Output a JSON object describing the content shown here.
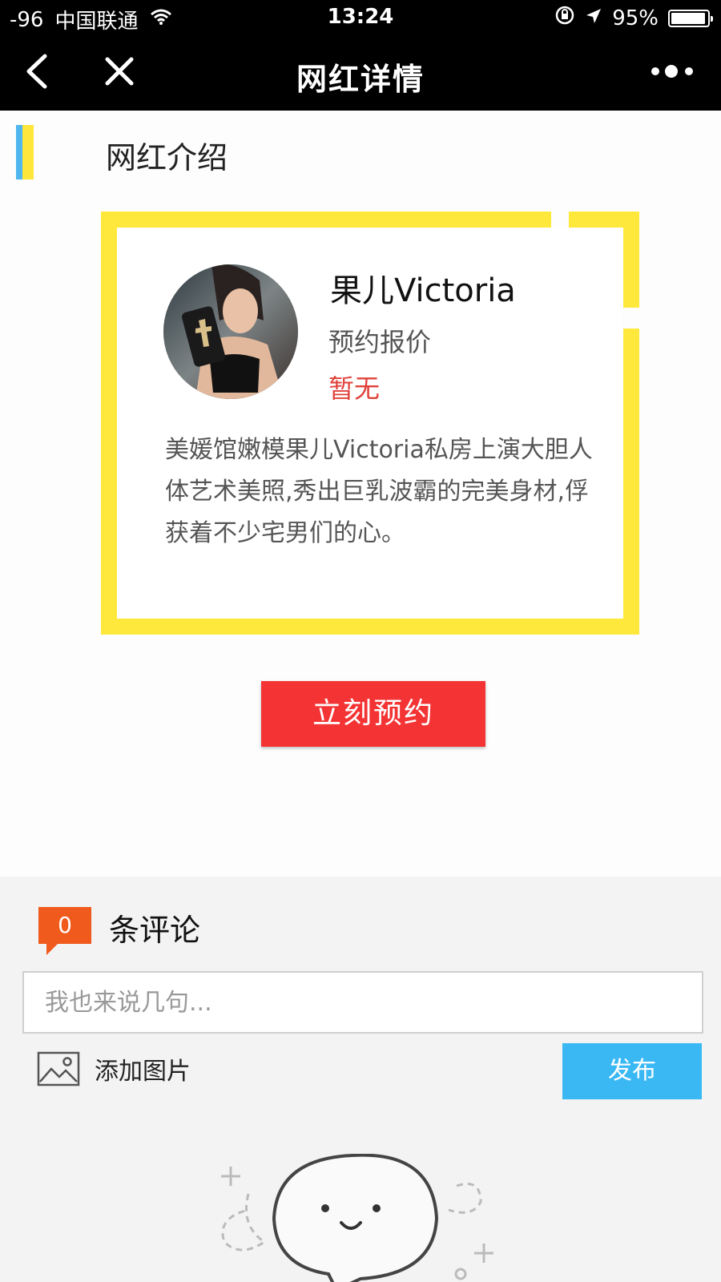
{
  "status_bar": {
    "signal": "-96",
    "carrier": "中国联通",
    "time": "13:24",
    "battery_percent": "95%",
    "battery_level": 0.95
  },
  "nav": {
    "title": "网红详情"
  },
  "section": {
    "title": "网红介绍"
  },
  "profile": {
    "name": "果儿Victoria",
    "price_label": "预约报价",
    "price_value": "暂无",
    "bio": "美媛馆嫩模果儿Victoria私房上演大胆人体艺术美照,秀出巨乳波霸的完美身材,俘获着不少宅男们的心。"
  },
  "book_button": "立刻预约",
  "comments": {
    "count": "0",
    "count_label": "条评论",
    "input_placeholder": "我也来说几句...",
    "add_image_label": "添加图片",
    "publish_label": "发布"
  },
  "colors": {
    "accent_yellow": "#ffe83c",
    "accent_blue": "#4fb7ee",
    "book_red": "#f43434",
    "price_red": "#e0423b",
    "badge_orange": "#f05a1c",
    "publish_blue": "#3ab8f4"
  }
}
